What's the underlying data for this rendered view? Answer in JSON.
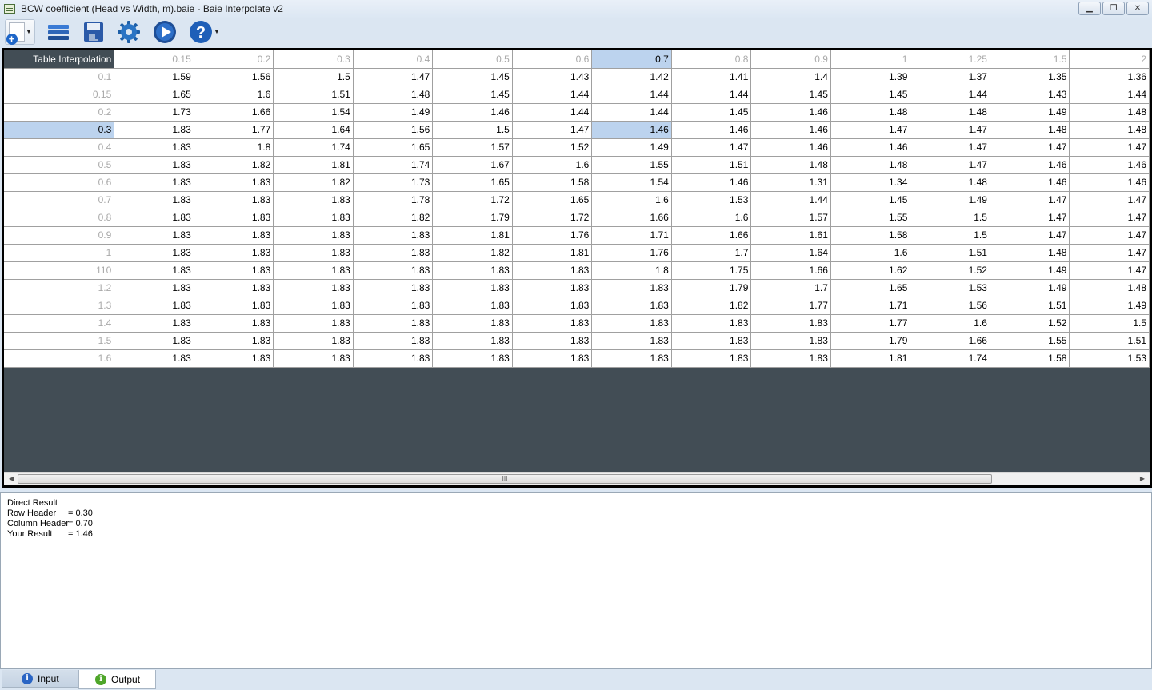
{
  "window": {
    "title": "BCW coefficient (Head vs Width, m).baie - Baie Interpolate v2",
    "controls": {
      "minimize": "▁",
      "restore": "❐",
      "close": "✕"
    }
  },
  "toolbar": {
    "icons": [
      "new-document-icon",
      "open-folder-icon",
      "save-disk-icon",
      "settings-gear-icon",
      "run-play-icon",
      "help-question-icon"
    ],
    "help_glyph": "?"
  },
  "grid": {
    "corner_label": "Table Interpolation",
    "column_headers": [
      "0.15",
      "0.2",
      "0.3",
      "0.4",
      "0.5",
      "0.6",
      "0.7",
      "0.8",
      "0.9",
      "1",
      "1.25",
      "1.5",
      "2"
    ],
    "rows": [
      {
        "header": "0.1",
        "values": [
          "1.59",
          "1.56",
          "1.5",
          "1.47",
          "1.45",
          "1.43",
          "1.42",
          "1.41",
          "1.4",
          "1.39",
          "1.37",
          "1.35",
          "1.36"
        ]
      },
      {
        "header": "0.15",
        "values": [
          "1.65",
          "1.6",
          "1.51",
          "1.48",
          "1.45",
          "1.44",
          "1.44",
          "1.44",
          "1.45",
          "1.45",
          "1.44",
          "1.43",
          "1.44"
        ]
      },
      {
        "header": "0.2",
        "values": [
          "1.73",
          "1.66",
          "1.54",
          "1.49",
          "1.46",
          "1.44",
          "1.44",
          "1.45",
          "1.46",
          "1.48",
          "1.48",
          "1.49",
          "1.48"
        ]
      },
      {
        "header": "0.3",
        "values": [
          "1.83",
          "1.77",
          "1.64",
          "1.56",
          "1.5",
          "1.47",
          "1.46",
          "1.46",
          "1.46",
          "1.47",
          "1.47",
          "1.48",
          "1.48"
        ]
      },
      {
        "header": "0.4",
        "values": [
          "1.83",
          "1.8",
          "1.74",
          "1.65",
          "1.57",
          "1.52",
          "1.49",
          "1.47",
          "1.46",
          "1.46",
          "1.47",
          "1.47",
          "1.47"
        ]
      },
      {
        "header": "0.5",
        "values": [
          "1.83",
          "1.82",
          "1.81",
          "1.74",
          "1.67",
          "1.6",
          "1.55",
          "1.51",
          "1.48",
          "1.48",
          "1.47",
          "1.46",
          "1.46"
        ]
      },
      {
        "header": "0.6",
        "values": [
          "1.83",
          "1.83",
          "1.82",
          "1.73",
          "1.65",
          "1.58",
          "1.54",
          "1.46",
          "1.31",
          "1.34",
          "1.48",
          "1.46",
          "1.46"
        ]
      },
      {
        "header": "0.7",
        "values": [
          "1.83",
          "1.83",
          "1.83",
          "1.78",
          "1.72",
          "1.65",
          "1.6",
          "1.53",
          "1.44",
          "1.45",
          "1.49",
          "1.47",
          "1.47"
        ]
      },
      {
        "header": "0.8",
        "values": [
          "1.83",
          "1.83",
          "1.83",
          "1.82",
          "1.79",
          "1.72",
          "1.66",
          "1.6",
          "1.57",
          "1.55",
          "1.5",
          "1.47",
          "1.47"
        ]
      },
      {
        "header": "0.9",
        "values": [
          "1.83",
          "1.83",
          "1.83",
          "1.83",
          "1.81",
          "1.76",
          "1.71",
          "1.66",
          "1.61",
          "1.58",
          "1.5",
          "1.47",
          "1.47"
        ]
      },
      {
        "header": "1",
        "values": [
          "1.83",
          "1.83",
          "1.83",
          "1.83",
          "1.82",
          "1.81",
          "1.76",
          "1.7",
          "1.64",
          "1.6",
          "1.51",
          "1.48",
          "1.47"
        ]
      },
      {
        "header": "110",
        "values": [
          "1.83",
          "1.83",
          "1.83",
          "1.83",
          "1.83",
          "1.83",
          "1.8",
          "1.75",
          "1.66",
          "1.62",
          "1.52",
          "1.49",
          "1.47"
        ]
      },
      {
        "header": "1.2",
        "values": [
          "1.83",
          "1.83",
          "1.83",
          "1.83",
          "1.83",
          "1.83",
          "1.83",
          "1.79",
          "1.7",
          "1.65",
          "1.53",
          "1.49",
          "1.48"
        ]
      },
      {
        "header": "1.3",
        "values": [
          "1.83",
          "1.83",
          "1.83",
          "1.83",
          "1.83",
          "1.83",
          "1.83",
          "1.82",
          "1.77",
          "1.71",
          "1.56",
          "1.51",
          "1.49"
        ]
      },
      {
        "header": "1.4",
        "values": [
          "1.83",
          "1.83",
          "1.83",
          "1.83",
          "1.83",
          "1.83",
          "1.83",
          "1.83",
          "1.83",
          "1.77",
          "1.6",
          "1.52",
          "1.5"
        ]
      },
      {
        "header": "1.5",
        "values": [
          "1.83",
          "1.83",
          "1.83",
          "1.83",
          "1.83",
          "1.83",
          "1.83",
          "1.83",
          "1.83",
          "1.79",
          "1.66",
          "1.55",
          "1.51"
        ]
      },
      {
        "header": "1.6",
        "values": [
          "1.83",
          "1.83",
          "1.83",
          "1.83",
          "1.83",
          "1.83",
          "1.83",
          "1.83",
          "1.83",
          "1.81",
          "1.74",
          "1.58",
          "1.53"
        ]
      }
    ],
    "selected": {
      "row_index": 3,
      "col_index": 6
    },
    "scrollbar": {
      "left_arrow": "◀",
      "right_arrow": "▶",
      "grip": "III"
    }
  },
  "result": {
    "title": "Direct Result",
    "lines": [
      {
        "label": "Row Header",
        "value": "= 0.30"
      },
      {
        "label": "Column Header",
        "value": "= 0.70"
      },
      {
        "label": "Your Result",
        "value": "= 1.46"
      }
    ]
  },
  "tabs": [
    {
      "label": "Input",
      "icon": "info-icon",
      "glyph": "i"
    },
    {
      "label": "Output",
      "icon": "info-icon",
      "glyph": "i"
    }
  ]
}
